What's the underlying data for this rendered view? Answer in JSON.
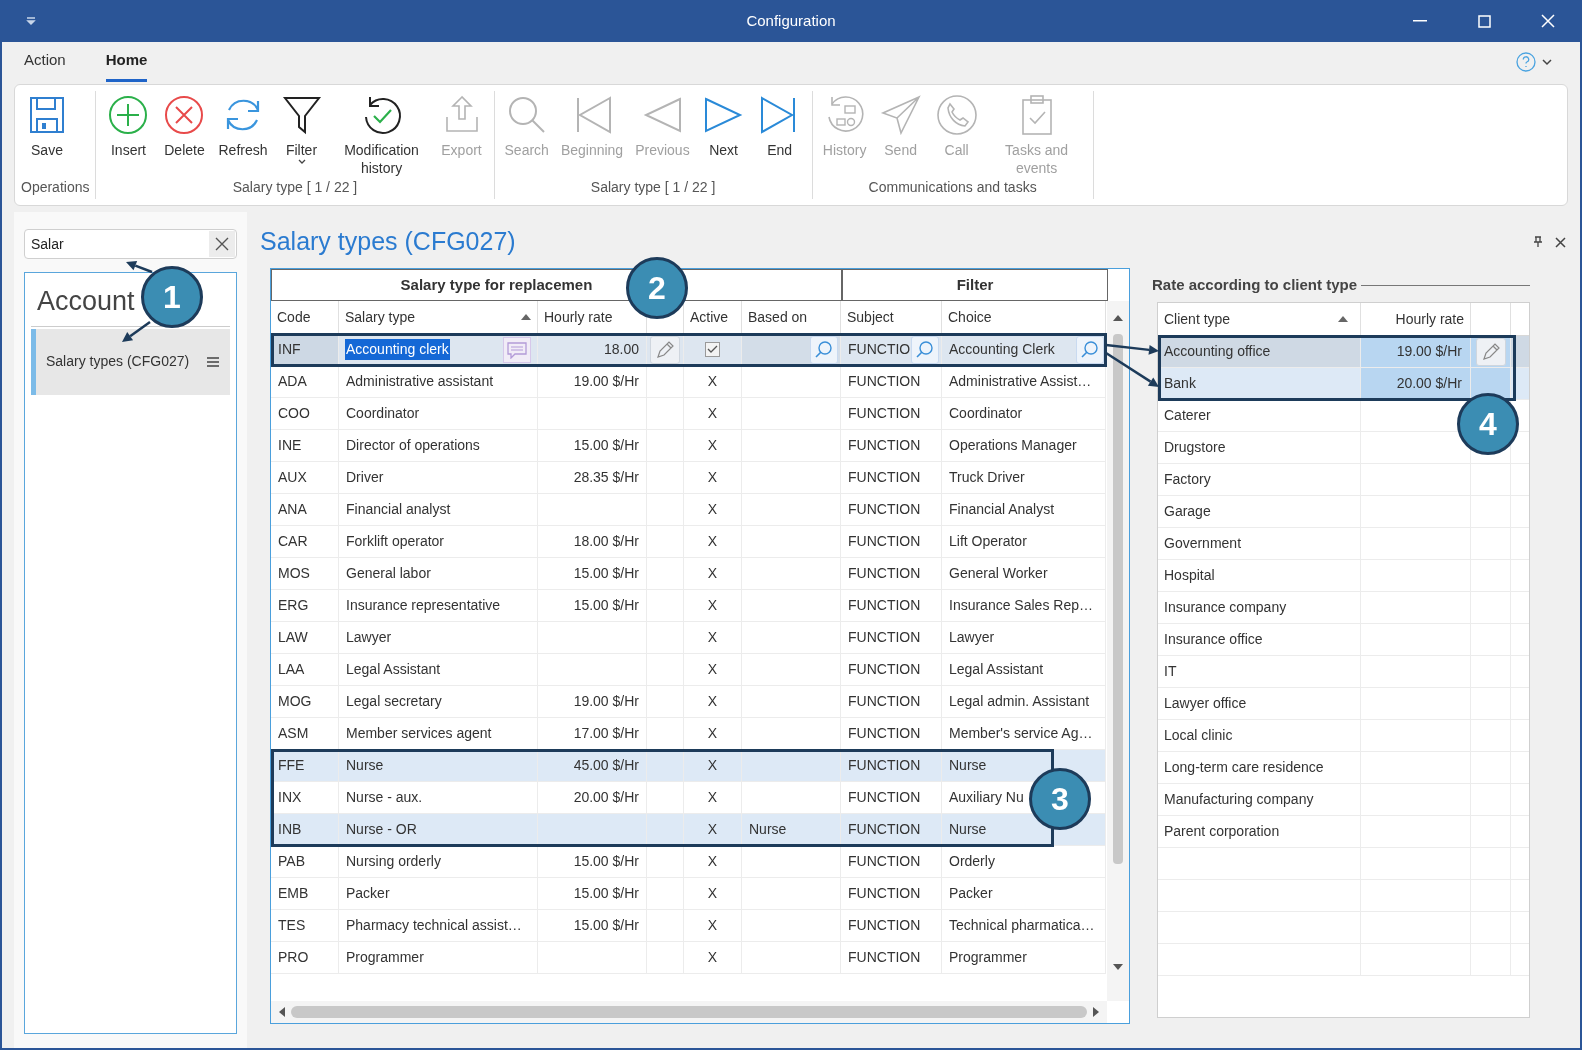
{
  "window": {
    "title": "Configuration"
  },
  "menu_tabs": [
    {
      "label": "Action",
      "selected": false
    },
    {
      "label": "Home",
      "selected": true
    }
  ],
  "ribbon": {
    "groups": [
      {
        "label": "Operations",
        "buttons": [
          {
            "kind": "save",
            "label": "Save",
            "disabled": false
          }
        ]
      },
      {
        "label": "Salary type [ 1 / 22 ]",
        "buttons": [
          {
            "kind": "insert",
            "label": "Insert",
            "disabled": false
          },
          {
            "kind": "delete",
            "label": "Delete",
            "disabled": false
          },
          {
            "kind": "refresh",
            "label": "Refresh",
            "disabled": false
          },
          {
            "kind": "filter",
            "label": "Filter",
            "disabled": false,
            "dropdown": true
          },
          {
            "kind": "modhistory",
            "label": "Modification history",
            "disabled": false
          },
          {
            "kind": "export",
            "label": "Export",
            "disabled": true
          }
        ]
      },
      {
        "label": "Salary type [ 1 / 22 ]",
        "buttons": [
          {
            "kind": "search",
            "label": "Search",
            "disabled": true
          },
          {
            "kind": "first",
            "label": "Beginning",
            "disabled": true
          },
          {
            "kind": "previous",
            "label": "Previous",
            "disabled": true
          },
          {
            "kind": "next",
            "label": "Next",
            "disabled": false
          },
          {
            "kind": "last",
            "label": "End",
            "disabled": false
          }
        ]
      },
      {
        "label": "Communications and tasks",
        "buttons": [
          {
            "kind": "commhistory",
            "label": "History",
            "disabled": true
          },
          {
            "kind": "send",
            "label": "Send",
            "disabled": true
          },
          {
            "kind": "call",
            "label": "Call",
            "disabled": true
          },
          {
            "kind": "tasks",
            "label": "Tasks and events",
            "disabled": true
          }
        ]
      }
    ]
  },
  "sidebar": {
    "search": {
      "value": "Salar"
    },
    "module": {
      "title": "Account"
    },
    "items": [
      {
        "label": "Salary types (CFG027)",
        "selected": true
      }
    ]
  },
  "main": {
    "title": "Salary types (CFG027)",
    "grid": {
      "group_headers": [
        "Salary type for replacemen",
        "Filter"
      ],
      "columns": [
        {
          "label": "Code",
          "sorted": false
        },
        {
          "label": "Salary type",
          "sorted": true
        },
        {
          "label": "Hourly rate",
          "sorted": false
        },
        {
          "label": "Active",
          "sorted": false
        },
        {
          "label": "Based on",
          "sorted": false
        },
        {
          "label": "Subject",
          "sorted": false
        },
        {
          "label": "Choice",
          "sorted": false
        }
      ],
      "rows": [
        {
          "kind": "edit",
          "code": "INF",
          "salary_type": "Accounting clerk",
          "hourly_rate": "18.00",
          "active_checked": true,
          "based_on": "",
          "subject": "FUNCTIO",
          "choice": "Accounting Clerk",
          "selected": true
        },
        {
          "kind": "plain",
          "code": "ADA",
          "salary_type": "Administrative assistant",
          "hourly_rate": "19.00 $/Hr",
          "active": "X",
          "based_on": "",
          "subject": "FUNCTION",
          "choice": "Administrative Assist…",
          "selected": false
        },
        {
          "kind": "plain",
          "code": "COO",
          "salary_type": "Coordinator",
          "hourly_rate": "",
          "active": "X",
          "based_on": "",
          "subject": "FUNCTION",
          "choice": "Coordinator",
          "selected": false
        },
        {
          "kind": "plain",
          "code": "INE",
          "salary_type": "Director of operations",
          "hourly_rate": "15.00 $/Hr",
          "active": "X",
          "based_on": "",
          "subject": "FUNCTION",
          "choice": "Operations Manager",
          "selected": false
        },
        {
          "kind": "plain",
          "code": "AUX",
          "salary_type": "Driver",
          "hourly_rate": "28.35 $/Hr",
          "active": "X",
          "based_on": "",
          "subject": "FUNCTION",
          "choice": "Truck Driver",
          "selected": false
        },
        {
          "kind": "plain",
          "code": "ANA",
          "salary_type": "Financial analyst",
          "hourly_rate": "",
          "active": "X",
          "based_on": "",
          "subject": "FUNCTION",
          "choice": "Financial Analyst",
          "selected": false
        },
        {
          "kind": "plain",
          "code": "CAR",
          "salary_type": "Forklift operator",
          "hourly_rate": "18.00 $/Hr",
          "active": "X",
          "based_on": "",
          "subject": "FUNCTION",
          "choice": "Lift Operator",
          "selected": false
        },
        {
          "kind": "plain",
          "code": "MOS",
          "salary_type": "General labor",
          "hourly_rate": "15.00 $/Hr",
          "active": "X",
          "based_on": "",
          "subject": "FUNCTION",
          "choice": "General Worker",
          "selected": false
        },
        {
          "kind": "plain",
          "code": "ERG",
          "salary_type": "Insurance representative",
          "hourly_rate": "15.00 $/Hr",
          "active": "X",
          "based_on": "",
          "subject": "FUNCTION",
          "choice": "Insurance Sales Rep…",
          "selected": false
        },
        {
          "kind": "plain",
          "code": "LAW",
          "salary_type": "Lawyer",
          "hourly_rate": "",
          "active": "X",
          "based_on": "",
          "subject": "FUNCTION",
          "choice": "Lawyer",
          "selected": false
        },
        {
          "kind": "plain",
          "code": "LAA",
          "salary_type": "Legal Assistant",
          "hourly_rate": "",
          "active": "X",
          "based_on": "",
          "subject": "FUNCTION",
          "choice": "Legal Assistant",
          "selected": false
        },
        {
          "kind": "plain",
          "code": "MOG",
          "salary_type": "Legal secretary",
          "hourly_rate": "19.00 $/Hr",
          "active": "X",
          "based_on": "",
          "subject": "FUNCTION",
          "choice": "Legal admin. Assistant",
          "selected": false
        },
        {
          "kind": "plain",
          "code": "ASM",
          "salary_type": "Member services agent",
          "hourly_rate": "17.00 $/Hr",
          "active": "X",
          "based_on": "",
          "subject": "FUNCTION",
          "choice": "Member's service Ag…",
          "selected": false
        },
        {
          "kind": "plain",
          "code": "FFE",
          "salary_type": "Nurse",
          "hourly_rate": "45.00 $/Hr",
          "active": "X",
          "based_on": "",
          "subject": "FUNCTION",
          "choice": "Nurse",
          "selected": true
        },
        {
          "kind": "plain",
          "code": "INX",
          "salary_type": "Nurse - aux.",
          "hourly_rate": "20.00 $/Hr",
          "active": "X",
          "based_on": "",
          "subject": "FUNCTION",
          "choice": "Auxiliary Nu",
          "selected": false
        },
        {
          "kind": "plain",
          "code": "INB",
          "salary_type": "Nurse - OR",
          "hourly_rate": "",
          "active": "X",
          "based_on": "Nurse",
          "subject": "FUNCTION",
          "choice": "Nurse",
          "selected": true
        },
        {
          "kind": "plain",
          "code": "PAB",
          "salary_type": "Nursing orderly",
          "hourly_rate": "15.00 $/Hr",
          "active": "X",
          "based_on": "",
          "subject": "FUNCTION",
          "choice": "Orderly",
          "selected": false
        },
        {
          "kind": "plain",
          "code": "EMB",
          "salary_type": "Packer",
          "hourly_rate": "15.00 $/Hr",
          "active": "X",
          "based_on": "",
          "subject": "FUNCTION",
          "choice": "Packer",
          "selected": false
        },
        {
          "kind": "plain",
          "code": "TES",
          "salary_type": "Pharmacy technical assist…",
          "hourly_rate": "15.00 $/Hr",
          "active": "X",
          "based_on": "",
          "subject": "FUNCTION",
          "choice": "Technical pharmatica…",
          "selected": false
        },
        {
          "kind": "plain",
          "code": "PRO",
          "salary_type": "Programmer",
          "hourly_rate": "",
          "active": "X",
          "based_on": "",
          "subject": "FUNCTION",
          "choice": "Programmer",
          "selected": false
        }
      ]
    },
    "rates": {
      "title": "Rate according to client type",
      "columns": [
        {
          "label": "Client type",
          "sorted": true
        },
        {
          "label": "Hourly rate",
          "sorted": false
        }
      ],
      "rows": [
        {
          "client_type": "Accounting office",
          "hourly_rate": "19.00 $/Hr",
          "selected": true,
          "editing": true
        },
        {
          "client_type": "Bank",
          "hourly_rate": "20.00 $/Hr",
          "selected": true,
          "editing": false
        },
        {
          "client_type": "Caterer",
          "hourly_rate": "",
          "selected": false,
          "editing": false
        },
        {
          "client_type": "Drugstore",
          "hourly_rate": "",
          "selected": false,
          "editing": false
        },
        {
          "client_type": "Factory",
          "hourly_rate": "",
          "selected": false,
          "editing": false
        },
        {
          "client_type": "Garage",
          "hourly_rate": "",
          "selected": false,
          "editing": false
        },
        {
          "client_type": "Government",
          "hourly_rate": "",
          "selected": false,
          "editing": false
        },
        {
          "client_type": "Hospital",
          "hourly_rate": "",
          "selected": false,
          "editing": false
        },
        {
          "client_type": "Insurance company",
          "hourly_rate": "",
          "selected": false,
          "editing": false
        },
        {
          "client_type": "Insurance office",
          "hourly_rate": "",
          "selected": false,
          "editing": false
        },
        {
          "client_type": "IT",
          "hourly_rate": "",
          "selected": false,
          "editing": false
        },
        {
          "client_type": "Lawyer office",
          "hourly_rate": "",
          "selected": false,
          "editing": false
        },
        {
          "client_type": "Local clinic",
          "hourly_rate": "",
          "selected": false,
          "editing": false
        },
        {
          "client_type": "Long-term care residence",
          "hourly_rate": "",
          "selected": false,
          "editing": false
        },
        {
          "client_type": "Manufacturing company",
          "hourly_rate": "",
          "selected": false,
          "editing": false
        },
        {
          "client_type": "Parent corporation",
          "hourly_rate": "",
          "selected": false,
          "editing": false
        }
      ]
    }
  },
  "callouts": [
    "1",
    "2",
    "3",
    "4"
  ]
}
